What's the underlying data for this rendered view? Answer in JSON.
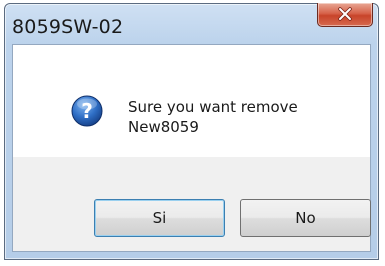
{
  "window": {
    "title": "8059SW-02"
  },
  "icons": {
    "close": "close-icon",
    "message": "question-icon"
  },
  "dialog": {
    "message_line1": "Sure you want remove",
    "message_line2": "New8059"
  },
  "buttons": {
    "yes_label": "Si",
    "no_label": "No"
  },
  "colors": {
    "close_button": "#c8442a",
    "question_icon": "#1f5fb5",
    "frame": "#bcd3ec"
  }
}
